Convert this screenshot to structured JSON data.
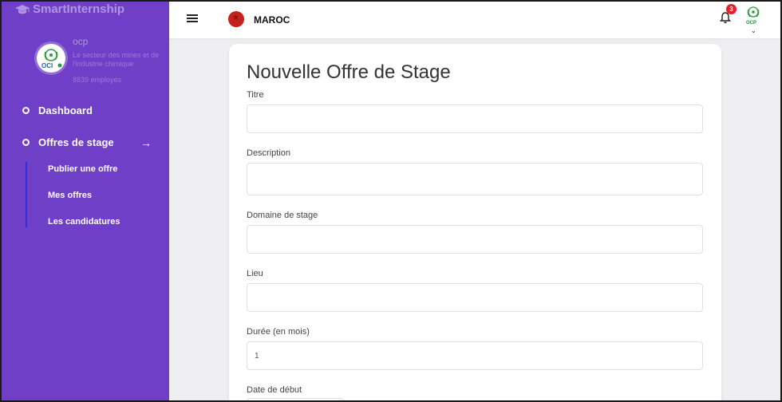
{
  "app": {
    "brand": "SmartInternship"
  },
  "organization": {
    "name": "ocp",
    "sector": "Le secteur des mines et de l'industrie chimique",
    "employees": "8839 employés",
    "logo_label": "OCI",
    "colors": {
      "green": "#2e9b3e",
      "blue": "#1f5fb5"
    }
  },
  "sidebar": {
    "items": [
      {
        "label": "Dashboard",
        "icon": "circle-bullet-icon"
      },
      {
        "label": "Offres de stage",
        "icon": "circle-bullet-icon",
        "arrow": "→"
      }
    ],
    "subitems": [
      {
        "label": "Publier une offre"
      },
      {
        "label": "Mes offres"
      },
      {
        "label": "Les candidatures"
      }
    ],
    "color": "#6f3fc7"
  },
  "topbar": {
    "country": "MAROC",
    "notifications": "3",
    "avatar_label": "OCP"
  },
  "form": {
    "title": "Nouvelle Offre de Stage",
    "fields": [
      {
        "label": "Titre",
        "value": ""
      },
      {
        "label": "Description",
        "value": ""
      },
      {
        "label": "Domaine de stage",
        "value": ""
      },
      {
        "label": "Lieu",
        "value": ""
      },
      {
        "label": "Durée (en mois)",
        "value": "1"
      },
      {
        "label": "Date de début",
        "value": ""
      }
    ]
  }
}
